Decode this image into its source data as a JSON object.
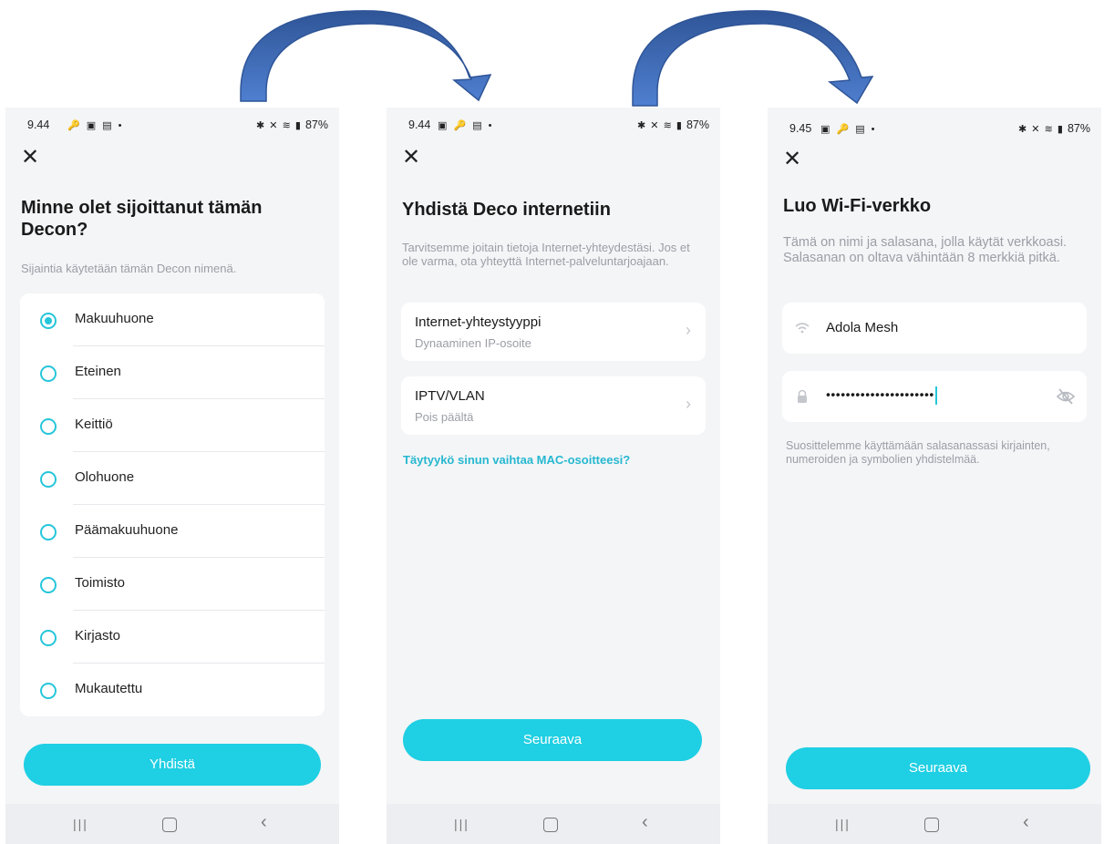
{
  "screens": [
    {
      "status_time": "9.44",
      "status_icons_left": "🔑 ▣ ▤ •",
      "status_battery": "87%",
      "title": "Minne olet sijoittanut tämän Decon?",
      "subtitle": "Sijaintia käytetään tämän Decon nimenä.",
      "options": [
        "Makuuhuone",
        "Eteinen",
        "Keittiö",
        "Olohuone",
        "Päämakuuhuone",
        "Toimisto",
        "Kirjasto",
        "Mukautettu"
      ],
      "selected_option": "Makuuhuone",
      "button": "Yhdistä"
    },
    {
      "status_time": "9.44",
      "status_icons_left": "▣ 🔑 ▤ •",
      "status_battery": "87%",
      "title": "Yhdistä Deco internetiin",
      "subtitle": "Tarvitsemme joitain tietoja Internet-yhteydestäsi. Jos et ole varma, ota yhteyttä Internet-palveluntarjoajaan.",
      "settings": [
        {
          "label": "Internet-yhteystyyppi",
          "value": "Dynaaminen IP-osoite"
        },
        {
          "label": "IPTV/VLAN",
          "value": "Pois päältä"
        }
      ],
      "link": "Täytyykö sinun vaihtaa MAC-osoitteesi?",
      "button": "Seuraava"
    },
    {
      "status_time": "9.45",
      "status_icons_left": "▣ 🔑 ▤ •",
      "status_battery": "87%",
      "title": "Luo Wi-Fi-verkko",
      "subtitle": "Tämä on nimi ja salasana, jolla käytät verkkoasi. Salasanan on oltava vähintään 8 merkkiä pitkä.",
      "network_name": "Adola Mesh",
      "password_masked": "••••••••••••••••••••••",
      "hint": "Suosittelemme käyttämään salasanassasi kirjainten, numeroiden ja symbolien yhdistelmää.",
      "button": "Seuraava"
    }
  ],
  "status_icons_right": "✱ ✕ ≋ ▮",
  "nav": {
    "recent": "|||",
    "back": "‹"
  },
  "close_glyph": "✕",
  "chevron_glyph": "›",
  "colors": {
    "accent": "#1fcfe3",
    "arrow": "#4472c4",
    "background": "#f4f5f7"
  }
}
